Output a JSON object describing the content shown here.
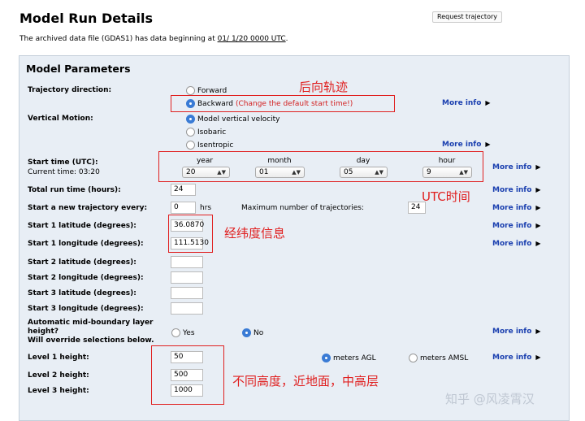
{
  "header": {
    "title": "Model Run Details",
    "request_button": "Request trajectory",
    "archive_prefix": "The archived data file (GDAS1) has data beginning at ",
    "archive_date": "01/ 1/20 0000 UTC",
    "archive_suffix": "."
  },
  "panel": {
    "title": "Model Parameters",
    "more_info": "More info",
    "trajectory_direction": {
      "label": "Trajectory direction:",
      "options": [
        "Forward",
        "Backward"
      ],
      "selected": "Backward",
      "note": "(Change the default start time!)"
    },
    "vertical_motion": {
      "label": "Vertical Motion:",
      "options": [
        "Model vertical velocity",
        "Isobaric",
        "Isentropic"
      ],
      "selected": "Model vertical velocity"
    },
    "start_time": {
      "label": "Start time (UTC):",
      "current": "Current time: 03:20",
      "columns": [
        "year",
        "month",
        "day",
        "hour"
      ],
      "values": [
        "20",
        "01",
        "05",
        "9"
      ]
    },
    "total_run_time": {
      "label": "Total run time (hours):",
      "value": "24"
    },
    "new_trajectory": {
      "label": "Start a new trajectory every:",
      "value": "0",
      "unit": "hrs",
      "max_label": "Maximum number of trajectories:",
      "max_value": "24"
    },
    "locations": [
      {
        "lat_label": "Start 1 latitude (degrees):",
        "lat": "36.0870",
        "lon_label": "Start 1 longitude (degrees):",
        "lon": "111.5130"
      },
      {
        "lat_label": "Start 2 latitude (degrees):",
        "lat": "",
        "lon_label": "Start 2 longitude (degrees):",
        "lon": ""
      },
      {
        "lat_label": "Start 3 latitude (degrees):",
        "lat": "",
        "lon_label": "Start 3 longitude (degrees):",
        "lon": ""
      }
    ],
    "auto_mid": {
      "label_line1": "Automatic mid-boundary layer",
      "label_line2": "height?",
      "label_line3": "Will override selections below.",
      "options": [
        "Yes",
        "No"
      ],
      "selected": "No"
    },
    "levels": [
      {
        "label": "Level 1 height:",
        "value": "50"
      },
      {
        "label": "Level 2 height:",
        "value": "500"
      },
      {
        "label": "Level 3 height:",
        "value": "1000"
      }
    ],
    "level_units": {
      "options": [
        "meters AGL",
        "meters AMSL"
      ],
      "selected": "meters AGL"
    }
  },
  "annotations": {
    "backward": "后向轨迹",
    "utc": "UTC时间",
    "latlon": "经纬度信息",
    "heights": "不同高度，近地面，中高层",
    "color": "#e02020"
  },
  "watermark": "知乎 @风凌霄汉"
}
